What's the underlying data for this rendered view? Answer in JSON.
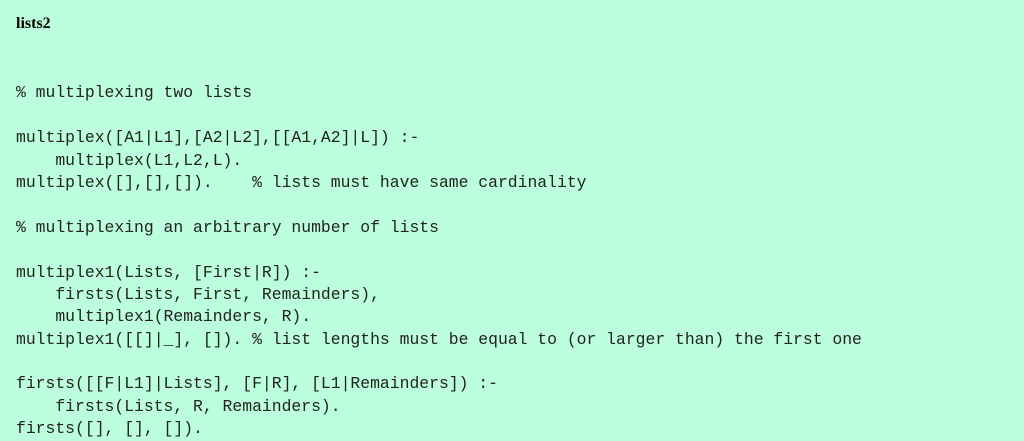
{
  "title": "lists2",
  "code_lines": [
    "",
    "% multiplexing two lists",
    "",
    "multiplex([A1|L1],[A2|L2],[[A1,A2]|L]) :-",
    "    multiplex(L1,L2,L).",
    "multiplex([],[],[]).    % lists must have same cardinality",
    "",
    "% multiplexing an arbitrary number of lists",
    "",
    "multiplex1(Lists, [First|R]) :-",
    "    firsts(Lists, First, Remainders),",
    "    multiplex1(Remainders, R).",
    "multiplex1([[]|_], []). % list lengths must be equal to (or larger than) the first one",
    "",
    "firsts([[F|L1]|Lists], [F|R], [L1|Remainders]) :-",
    "    firsts(Lists, R, Remainders).",
    "firsts([], [], [])."
  ]
}
